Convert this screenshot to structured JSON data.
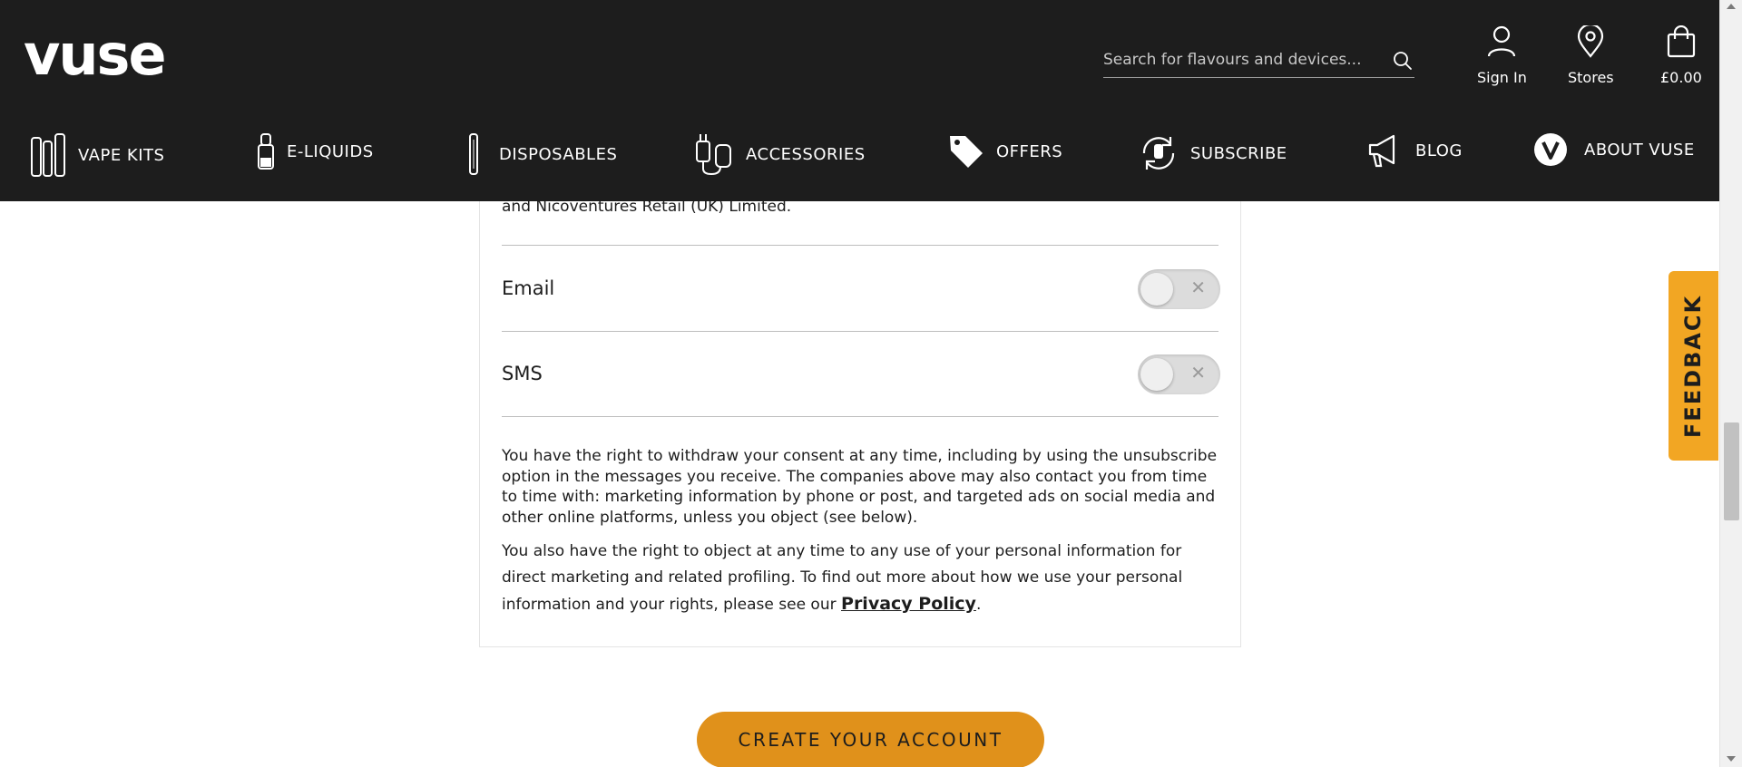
{
  "brand": {
    "logo_text": "vuse"
  },
  "search": {
    "placeholder": "Search for flavours and devices..."
  },
  "utility": {
    "sign_in": "Sign In",
    "stores": "Stores",
    "cart_total": "£0.00"
  },
  "nav": {
    "items": [
      {
        "label": "VAPE KITS",
        "icon": "vape-kits-icon"
      },
      {
        "label": "E-LIQUIDS",
        "icon": "e-liquid-pod-icon"
      },
      {
        "label": "DISPOSABLES",
        "icon": "disposable-vape-icon"
      },
      {
        "label": "ACCESSORIES",
        "icon": "charger-cable-icon"
      },
      {
        "label": "OFFERS",
        "icon": "price-tag-icon"
      },
      {
        "label": "SUBSCRIBE",
        "icon": "subscription-refresh-icon"
      },
      {
        "label": "BLOG",
        "icon": "megaphone-icon"
      },
      {
        "label": "ABOUT VUSE",
        "icon": "vuse-v-logo-icon"
      }
    ]
  },
  "consent": {
    "previous_text": "and Nicoventures Retail (UK) Limited.",
    "email_label": "Email",
    "sms_label": "SMS",
    "email_enabled": false,
    "sms_enabled": false,
    "toggle_off_glyph": "✕",
    "withdraw_text": "You have the right to withdraw your consent at any time, including by using the unsubscribe option in the messages you receive. The companies above may also contact you from time to time with: marketing information by phone or post, and targeted ads on social media and other online platforms, unless you object (see below).",
    "object_text": "You also have the right to object at any time to any use of your personal information for direct marketing and related profiling. To find out more about how we use your personal information and your rights, please see our",
    "privacy_link": "Privacy Policy",
    "privacy_suffix": "."
  },
  "cta": {
    "label": "CREATE YOUR ACCOUNT"
  },
  "feedback": {
    "label": "FEEDBACK"
  },
  "colors": {
    "header_bg": "#1d1d1d",
    "accent_orange": "#e0911b",
    "feedback_tab": "#f2a623"
  }
}
